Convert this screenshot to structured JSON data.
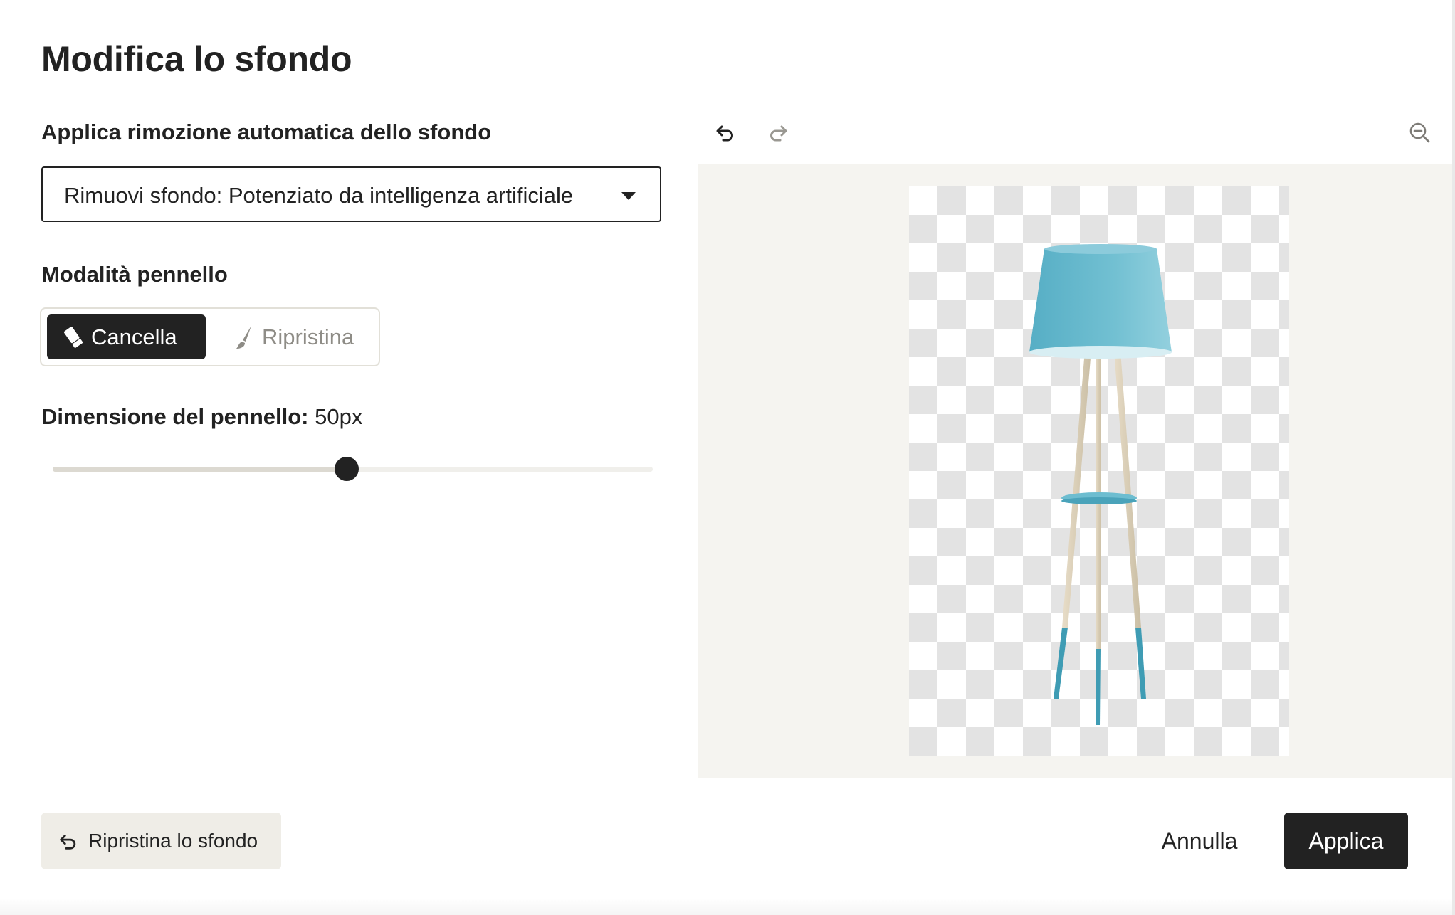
{
  "dialog": {
    "title": "Modifica lo sfondo"
  },
  "auto_removal": {
    "label": "Applica rimozione automatica dello sfondo",
    "selected": "Rimuovi sfondo: Potenziato da intelligenza artificiale"
  },
  "brush_mode": {
    "label": "Modalità pennello",
    "options": [
      {
        "label": "Cancella",
        "icon": "eraser-icon",
        "active": true
      },
      {
        "label": "Ripristina",
        "icon": "brush-icon",
        "active": false
      }
    ]
  },
  "brush_size": {
    "label": "Dimensione del pennello:",
    "value_text": "50px",
    "slider_fraction": 0.49
  },
  "toolbar": {
    "undo_icon": "undo-icon",
    "redo_icon": "redo-icon",
    "zoom_icon": "zoom-out-icon"
  },
  "footer": {
    "reset_label": "Ripristina lo sfondo",
    "cancel_label": "Annulla",
    "apply_label": "Applica"
  },
  "colors": {
    "primary": "#222222",
    "canvas_bg": "#f5f4f0",
    "secondary_button_bg": "#efede7",
    "muted_text": "#8e8c86",
    "lamp_shade": "#5fb4c9"
  }
}
